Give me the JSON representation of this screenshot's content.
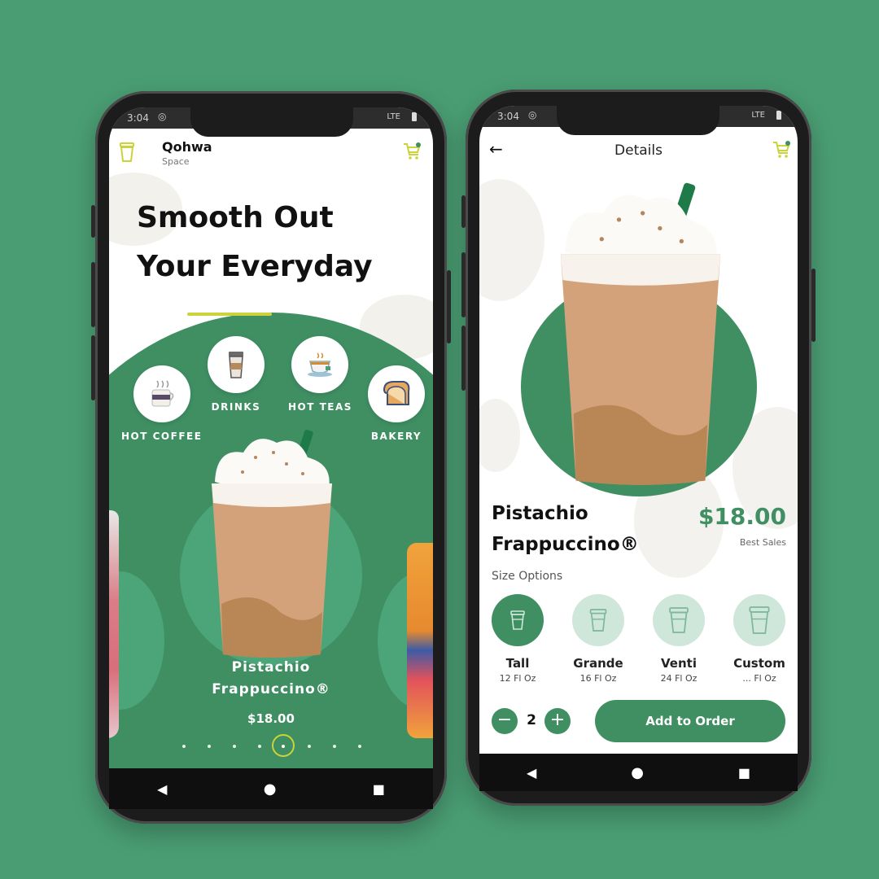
{
  "left_phone": {
    "status": {
      "time": "3:04",
      "network": "LTE"
    },
    "brand": {
      "name": "Qohwa",
      "sub": "Space"
    },
    "hero": {
      "line1": "Smooth Out",
      "line2": "Your Everyday"
    },
    "categories": [
      {
        "label": "HOT COFFEE",
        "icon": "coffee-cup-icon"
      },
      {
        "label": "DRINKS",
        "icon": "takeaway-cup-icon"
      },
      {
        "label": "HOT TEAS",
        "icon": "tea-cup-icon"
      },
      {
        "label": "BAKERY",
        "icon": "bread-icon"
      }
    ],
    "product": {
      "name1": "Pistachio",
      "name2": "Frappuccino®",
      "price": "$18.00"
    },
    "carousel": {
      "count": 8,
      "active_index": 4
    }
  },
  "right_phone": {
    "status": {
      "time": "3:04",
      "network": "LTE"
    },
    "header": {
      "title": "Details"
    },
    "product": {
      "name1": "Pistachio",
      "name2": "Frappuccino®",
      "price": "$18.00",
      "tag": "Best Sales"
    },
    "size_title": "Size Options",
    "sizes": [
      {
        "name": "Tall",
        "oz": "12 Fl Oz",
        "selected": true
      },
      {
        "name": "Grande",
        "oz": "16 Fl Oz",
        "selected": false
      },
      {
        "name": "Venti",
        "oz": "24 Fl Oz",
        "selected": false
      },
      {
        "name": "Custom",
        "oz": "... Fl Oz",
        "selected": false
      }
    ],
    "quantity": "2",
    "add_button": "Add to Order"
  },
  "colors": {
    "background": "#4a9d73",
    "brand_green": "#3f8f63",
    "accent_yellow": "#cbd33a"
  }
}
